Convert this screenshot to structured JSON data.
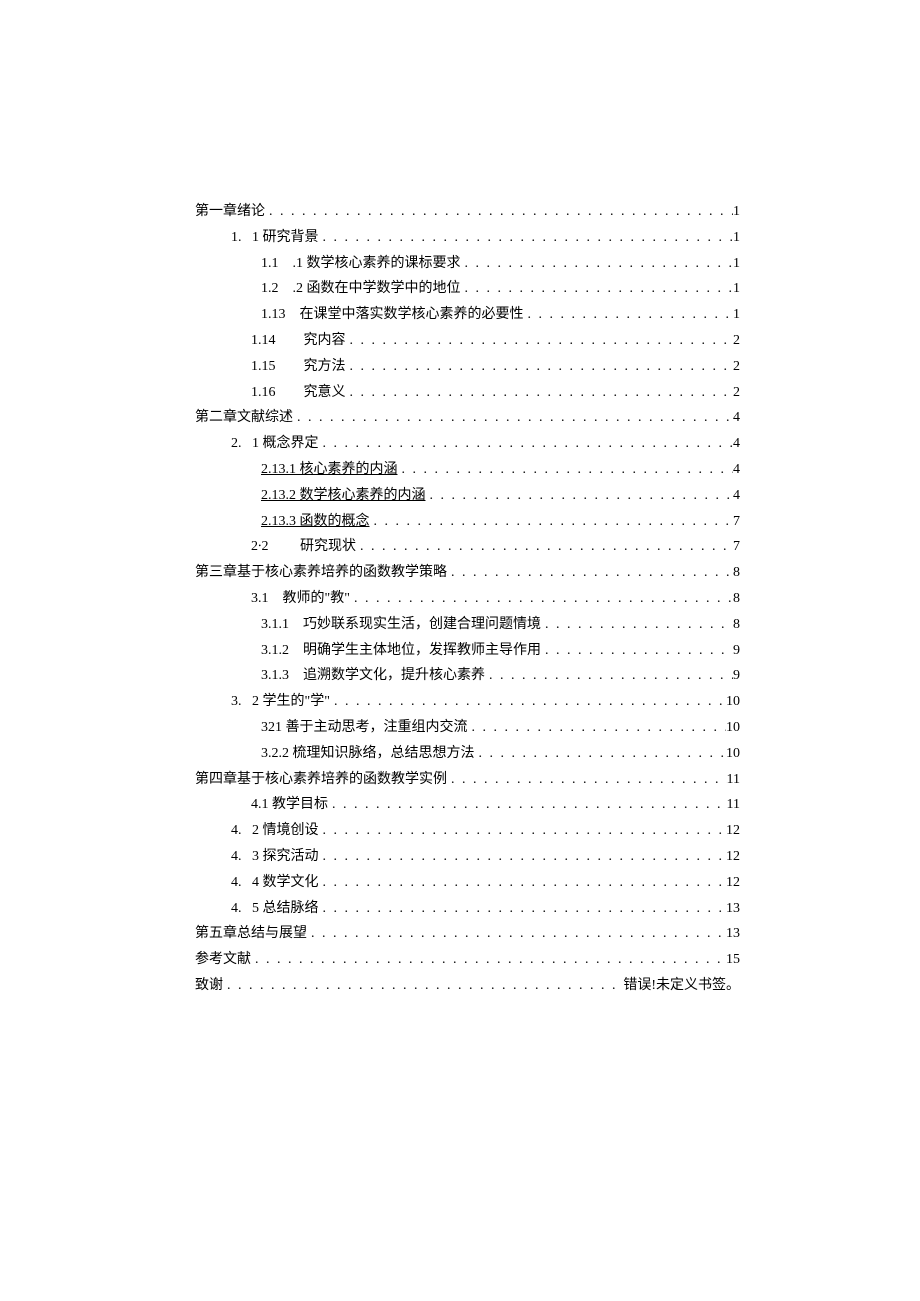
{
  "toc": {
    "entries": [
      {
        "indent": "level-0",
        "label": "第一章绪论",
        "page": "1",
        "underline": false
      },
      {
        "indent": "level-1",
        "label": "1.   1 研究背景",
        "page": "1",
        "underline": false
      },
      {
        "indent": "level-2",
        "label": "1.1    .1 数学核心素养的课标要求",
        "page": "1",
        "underline": false
      },
      {
        "indent": "level-2",
        "label": "1.2    .2 函数在中学数学中的地位",
        "page": "1",
        "underline": false
      },
      {
        "indent": "level-2",
        "label": "1.13    在课堂中落实数学核心素养的必要性",
        "page": "1",
        "underline": false
      },
      {
        "indent": "level-2b",
        "label": "1.14        究内容",
        "page": "2",
        "underline": false
      },
      {
        "indent": "level-2b",
        "label": "1.15        究方法",
        "page": "2",
        "underline": false
      },
      {
        "indent": "level-2b",
        "label": "1.16        究意义",
        "page": "2",
        "underline": false
      },
      {
        "indent": "level-0",
        "label": "第二章文献综述",
        "page": "4",
        "underline": false
      },
      {
        "indent": "level-1",
        "label": "2.   1 概念界定",
        "page": "4",
        "underline": false
      },
      {
        "indent": "level-2",
        "label": "2.13.1 核心素养的内涵",
        "page": "4",
        "underline": true
      },
      {
        "indent": "level-2",
        "label": "2.13.2 数学核心素养的内涵",
        "page": "4",
        "underline": true
      },
      {
        "indent": "level-2",
        "label": "2.13.3 函数的概念",
        "page": "7",
        "underline": true
      },
      {
        "indent": "level-2b",
        "label": "2∙2         研究现状",
        "page": "7",
        "underline": false
      },
      {
        "indent": "level-0",
        "label": "第三章基于核心素养培养的函数教学策略",
        "page": "8",
        "underline": false
      },
      {
        "indent": "level-1c",
        "label": "3.1    教师的\"教\"",
        "page": "8",
        "underline": false
      },
      {
        "indent": "level-2",
        "label": "3.1.1    巧妙联系现实生活，创建合理问题情境",
        "page": "8",
        "underline": false
      },
      {
        "indent": "level-2",
        "label": "3.1.2    明确学生主体地位，发挥教师主导作用",
        "page": "9",
        "underline": false
      },
      {
        "indent": "level-2",
        "label": "3.1.3    追溯数学文化，提升核心素养",
        "page": "9",
        "underline": false
      },
      {
        "indent": "level-1",
        "label": "3.   2 学生的\"学\"",
        "page": "10",
        "underline": false
      },
      {
        "indent": "level-2",
        "label": "321 善于主动思考，注重组内交流",
        "page": "10",
        "underline": false
      },
      {
        "indent": "level-2",
        "label": "3.2.2 梳理知识脉络，总结思想方法",
        "page": "10",
        "underline": false
      },
      {
        "indent": "level-0",
        "label": "第四章基于核心素养培养的函数教学实例",
        "page": "11",
        "underline": false
      },
      {
        "indent": "level-1c",
        "label": "4.1 教学目标",
        "page": "11",
        "underline": false
      },
      {
        "indent": "level-1",
        "label": "4.   2 情境创设",
        "page": "12",
        "underline": false
      },
      {
        "indent": "level-1",
        "label": "4.   3 探究活动",
        "page": "12",
        "underline": false
      },
      {
        "indent": "level-1b",
        "label": "4.   4 数学文化",
        "page": "12",
        "underline": false
      },
      {
        "indent": "level-1",
        "label": "4.   5 总结脉络",
        "page": "13",
        "underline": false
      },
      {
        "indent": "level-0",
        "label": "第五章总结与展望",
        "page": "13",
        "underline": false
      },
      {
        "indent": "level-0",
        "label": "参考文献",
        "page": "15",
        "underline": false
      },
      {
        "indent": "level-0",
        "label": "致谢",
        "page": "错误!未定义书签。",
        "underline": false
      }
    ]
  }
}
